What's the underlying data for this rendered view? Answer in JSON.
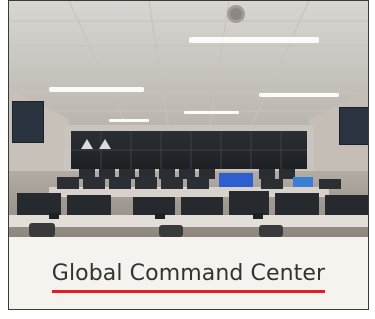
{
  "card": {
    "title": "Global Command Center",
    "image_subject": "command-center-room-photo"
  },
  "colors": {
    "underline": "#e31b23",
    "text": "#333333",
    "card_background": "#f6f2ed",
    "border": "#3a3a3a"
  }
}
